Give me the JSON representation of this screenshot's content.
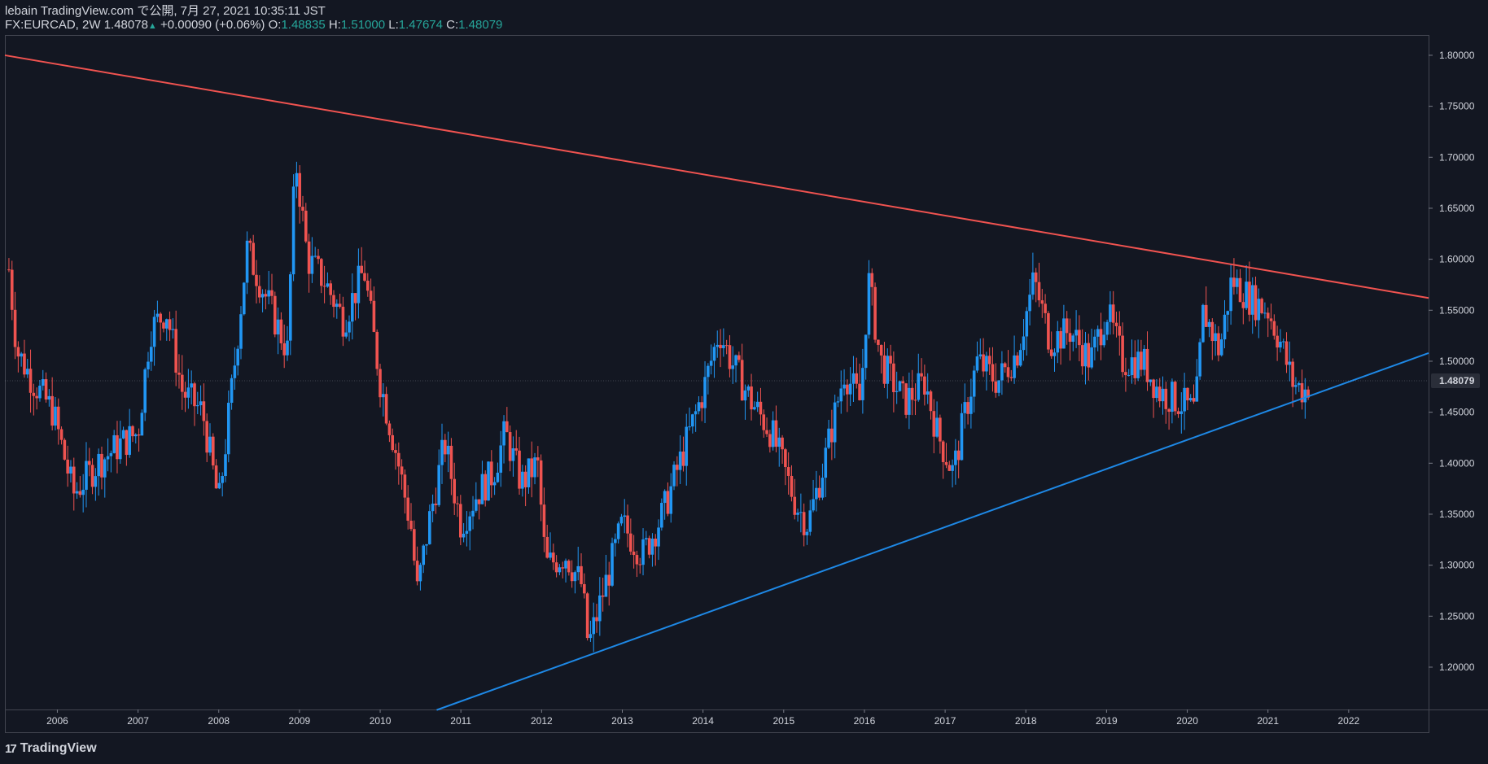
{
  "header": {
    "line1": "lebain TradingView.com で公開, 7月 27, 2021 10:35:11 JST",
    "symbol": "FX:EURCAD, 2W",
    "last": "1.48078",
    "up_arrow": "▲",
    "change": "+0.00090 (+0.06%)",
    "o_label": "O:",
    "o_value": "1.48835",
    "h_label": "H:",
    "h_value": "1.51000",
    "l_label": "L:",
    "l_value": "1.47674",
    "c_label": "C:",
    "c_value": "1.48079"
  },
  "footer": {
    "brand": "TradingView",
    "logo": "17"
  },
  "colors": {
    "background": "#131722",
    "up": "#2196f3",
    "down": "#ef5350",
    "resistance": "#f05350",
    "support": "#1e88e5",
    "text": "#d1d4dc",
    "accent": "#26a69a"
  },
  "chart_data": {
    "type": "candlestick",
    "symbol": "FX:EURCAD",
    "interval": "2W",
    "xlim": [
      2005.35,
      2022.99
    ],
    "ylim": [
      1.1585,
      1.8199
    ],
    "price_ticks": [
      "1.80000",
      "1.75000",
      "1.70000",
      "1.65000",
      "1.60000",
      "1.55000",
      "1.50000",
      "1.45000",
      "1.40000",
      "1.35000",
      "1.30000",
      "1.25000",
      "1.20000"
    ],
    "year_ticks": [
      "2006",
      "2007",
      "2008",
      "2009",
      "2010",
      "2011",
      "2012",
      "2013",
      "2014",
      "2015",
      "2016",
      "2017",
      "2018",
      "2019",
      "2020",
      "2021",
      "2022"
    ],
    "last_price_label": "1.48079",
    "last_price": 1.48079,
    "close_path": [
      [
        2005.4,
        1.59
      ],
      [
        2005.5,
        1.51
      ],
      [
        2005.7,
        1.48
      ],
      [
        2005.95,
        1.45
      ],
      [
        2006.2,
        1.37
      ],
      [
        2006.5,
        1.4
      ],
      [
        2006.8,
        1.42
      ],
      [
        2007.0,
        1.43
      ],
      [
        2007.15,
        1.53
      ],
      [
        2007.35,
        1.55
      ],
      [
        2007.55,
        1.47
      ],
      [
        2007.8,
        1.45
      ],
      [
        2008.0,
        1.36
      ],
      [
        2008.2,
        1.5
      ],
      [
        2008.35,
        1.61
      ],
      [
        2008.6,
        1.56
      ],
      [
        2008.85,
        1.51
      ],
      [
        2008.95,
        1.7
      ],
      [
        2009.1,
        1.6
      ],
      [
        2009.3,
        1.58
      ],
      [
        2009.55,
        1.54
      ],
      [
        2009.8,
        1.59
      ],
      [
        2010.0,
        1.48
      ],
      [
        2010.2,
        1.41
      ],
      [
        2010.4,
        1.33
      ],
      [
        2010.45,
        1.27
      ],
      [
        2010.6,
        1.34
      ],
      [
        2010.8,
        1.42
      ],
      [
        2011.0,
        1.34
      ],
      [
        2011.2,
        1.37
      ],
      [
        2011.4,
        1.39
      ],
      [
        2011.55,
        1.43
      ],
      [
        2011.75,
        1.38
      ],
      [
        2011.95,
        1.4
      ],
      [
        2012.05,
        1.3
      ],
      [
        2012.3,
        1.31
      ],
      [
        2012.5,
        1.28
      ],
      [
        2012.58,
        1.22
      ],
      [
        2012.75,
        1.27
      ],
      [
        2013.0,
        1.34
      ],
      [
        2013.25,
        1.31
      ],
      [
        2013.5,
        1.35
      ],
      [
        2013.75,
        1.41
      ],
      [
        2014.0,
        1.47
      ],
      [
        2014.2,
        1.53
      ],
      [
        2014.35,
        1.5
      ],
      [
        2014.6,
        1.46
      ],
      [
        2014.85,
        1.43
      ],
      [
        2015.15,
        1.36
      ],
      [
        2015.3,
        1.34
      ],
      [
        2015.5,
        1.4
      ],
      [
        2015.75,
        1.49
      ],
      [
        2015.95,
        1.46
      ],
      [
        2016.05,
        1.58
      ],
      [
        2016.2,
        1.5
      ],
      [
        2016.5,
        1.46
      ],
      [
        2016.75,
        1.48
      ],
      [
        2016.9,
        1.43
      ],
      [
        2017.1,
        1.39
      ],
      [
        2017.25,
        1.45
      ],
      [
        2017.4,
        1.5
      ],
      [
        2017.65,
        1.48
      ],
      [
        2017.9,
        1.51
      ],
      [
        2018.1,
        1.58
      ],
      [
        2018.3,
        1.52
      ],
      [
        2018.55,
        1.53
      ],
      [
        2018.8,
        1.5
      ],
      [
        2019.0,
        1.55
      ],
      [
        2019.2,
        1.5
      ],
      [
        2019.45,
        1.5
      ],
      [
        2019.65,
        1.47
      ],
      [
        2019.9,
        1.46
      ],
      [
        2020.1,
        1.45
      ],
      [
        2020.2,
        1.55
      ],
      [
        2020.4,
        1.51
      ],
      [
        2020.55,
        1.58
      ],
      [
        2020.8,
        1.56
      ],
      [
        2021.0,
        1.55
      ],
      [
        2021.15,
        1.52
      ],
      [
        2021.3,
        1.48
      ],
      [
        2021.45,
        1.47
      ],
      [
        2021.52,
        1.48
      ]
    ],
    "trendlines": [
      {
        "name": "resistance",
        "from": [
          2005.35,
          1.8
        ],
        "to": [
          2022.99,
          1.562
        ]
      },
      {
        "name": "support",
        "from": [
          2010.7,
          1.158
        ],
        "to": [
          2022.99,
          1.508
        ]
      }
    ]
  }
}
